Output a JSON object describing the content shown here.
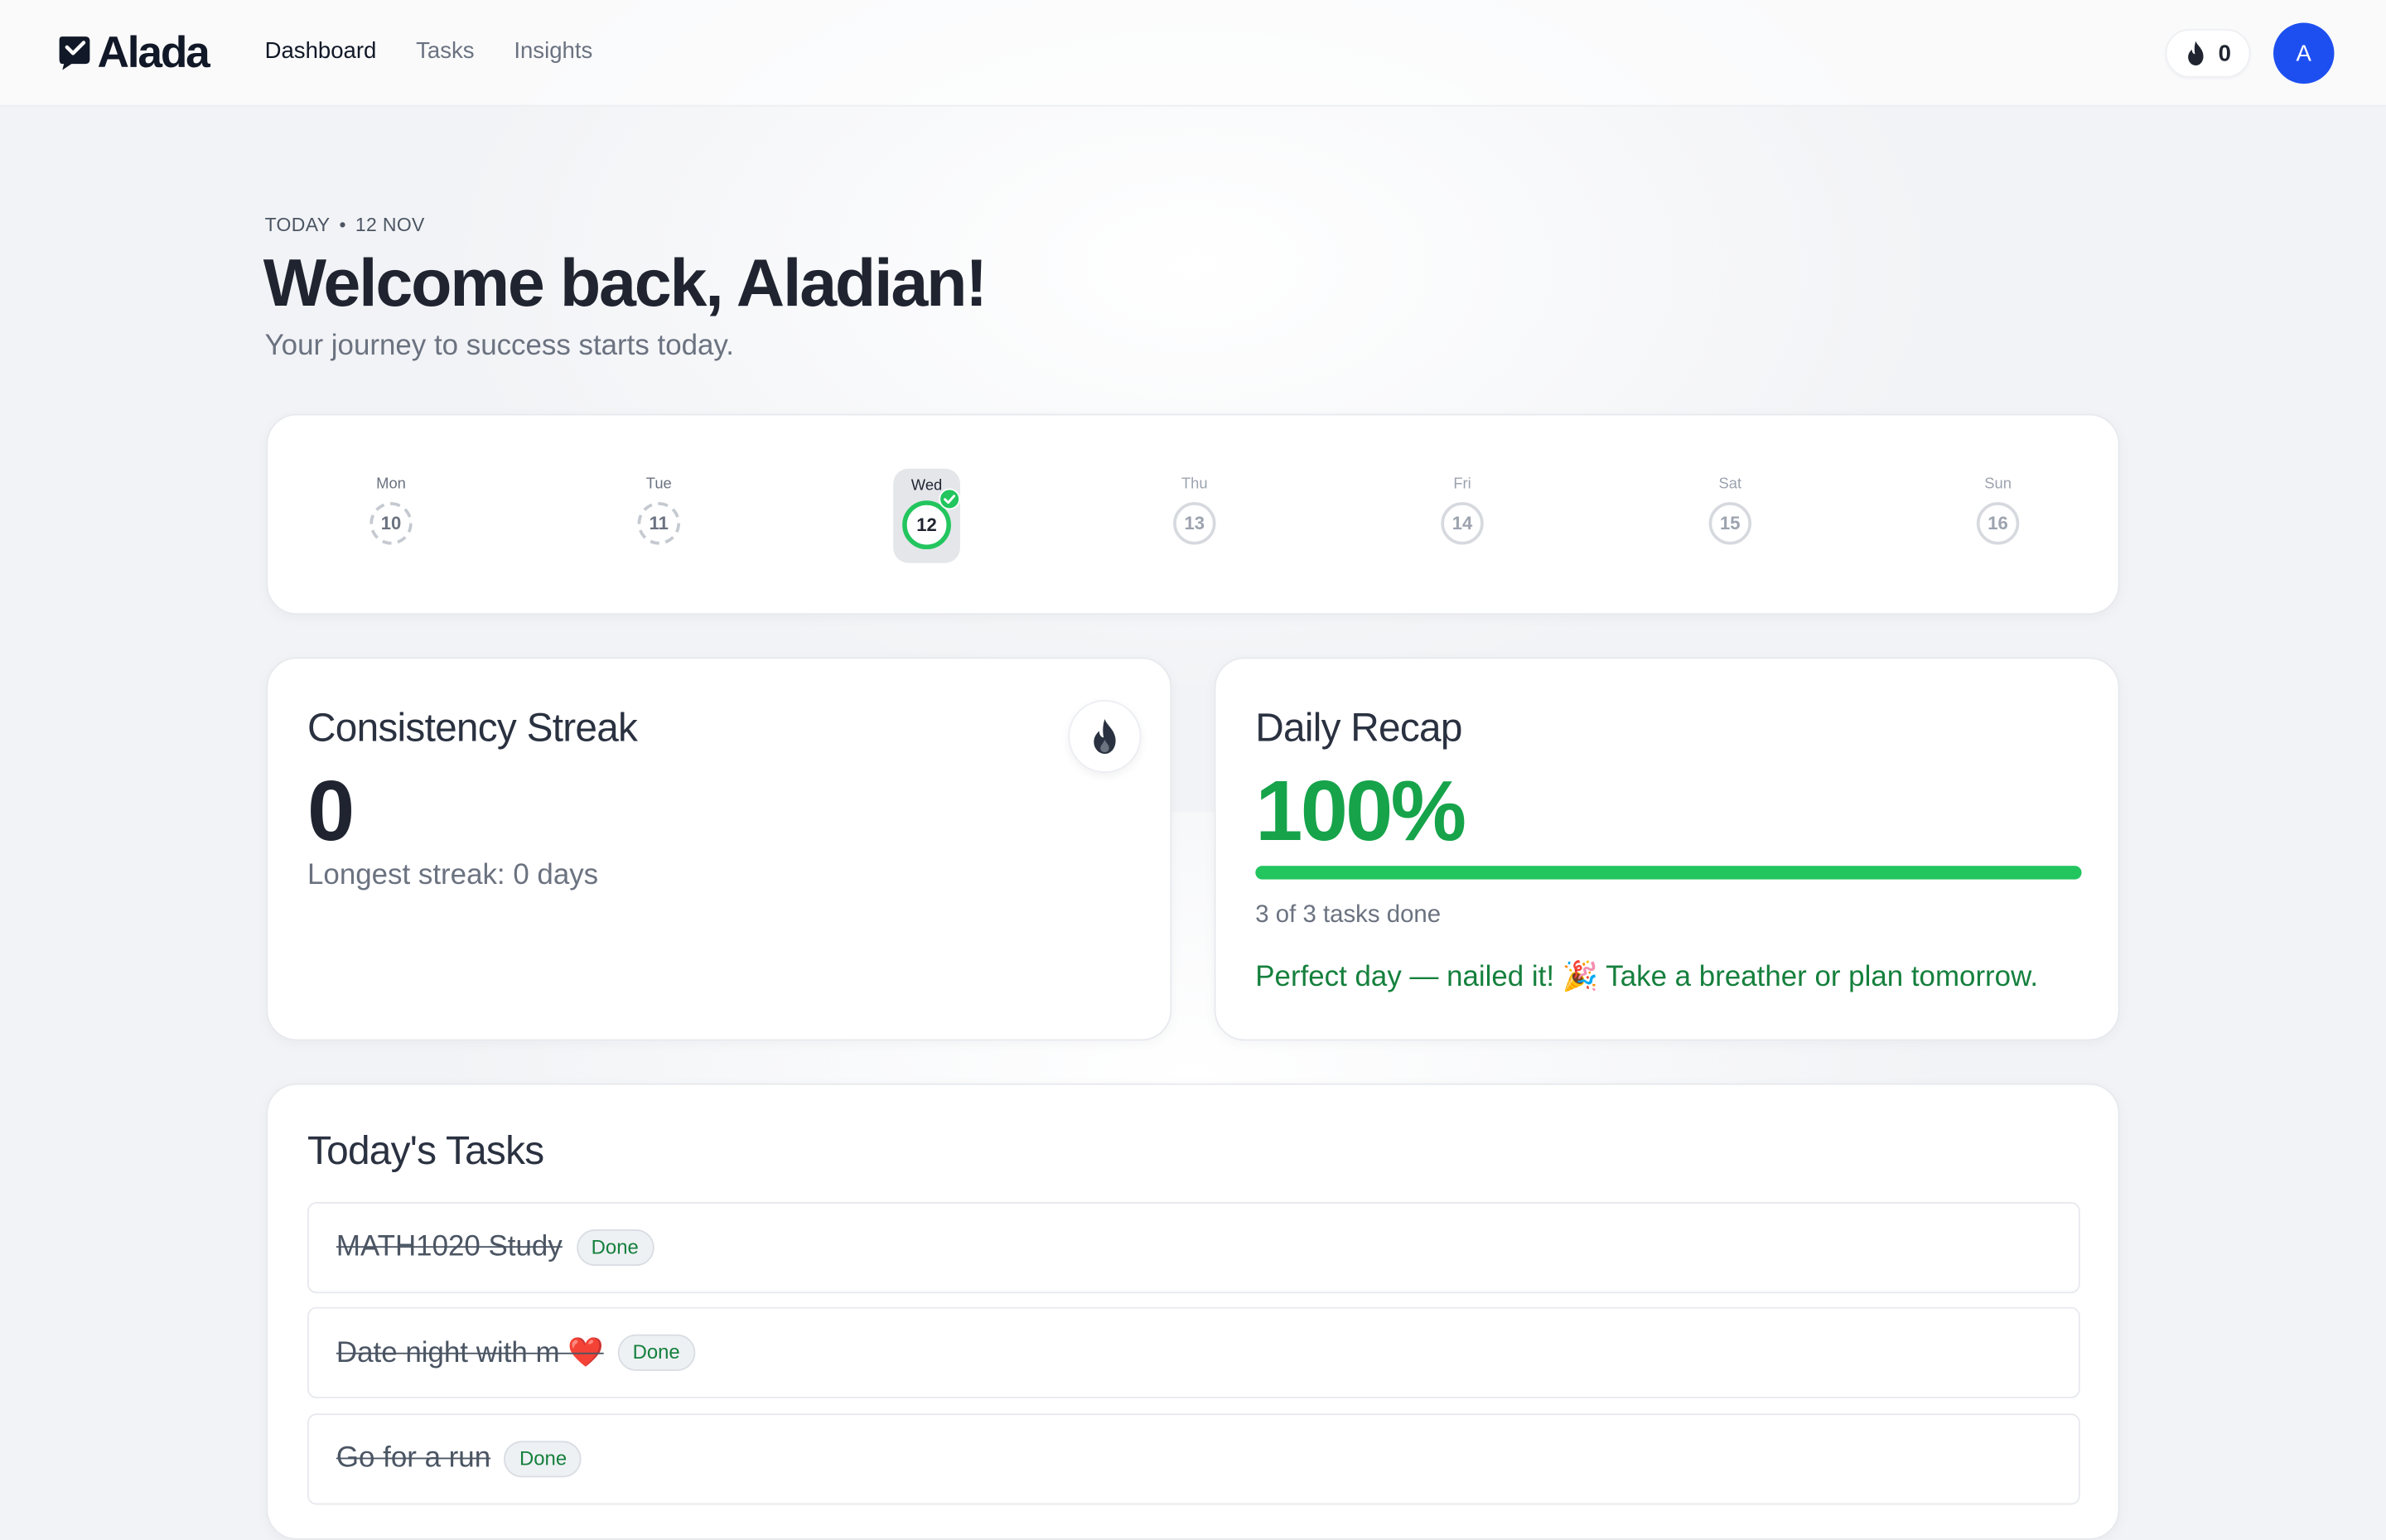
{
  "app": {
    "brand": "Alada",
    "nav": [
      {
        "label": "Dashboard",
        "active": true
      },
      {
        "label": "Tasks",
        "active": false
      },
      {
        "label": "Insights",
        "active": false
      }
    ],
    "streak_count": "0",
    "avatar_initial": "A",
    "avatar_color": "#1d4ff0"
  },
  "hero": {
    "eyebrow_day": "TODAY",
    "eyebrow_sep": "•",
    "eyebrow_date": "12 NOV",
    "title": "Welcome back, Aladian!",
    "subtitle": "Your journey to success starts today."
  },
  "week": {
    "days": [
      {
        "label": "Mon",
        "date": "10",
        "state": "past"
      },
      {
        "label": "Tue",
        "date": "11",
        "state": "past"
      },
      {
        "label": "Wed",
        "date": "12",
        "state": "today-complete"
      },
      {
        "label": "Thu",
        "date": "13",
        "state": "future"
      },
      {
        "label": "Fri",
        "date": "14",
        "state": "future"
      },
      {
        "label": "Sat",
        "date": "15",
        "state": "future"
      },
      {
        "label": "Sun",
        "date": "16",
        "state": "future"
      }
    ]
  },
  "streak": {
    "title": "Consistency Streak",
    "value": "0",
    "longest": "Longest streak: 0 days",
    "icon": "flame-icon"
  },
  "recap": {
    "title": "Daily Recap",
    "percent_label": "100%",
    "progress_fraction": 1.0,
    "count": "3 of 3 tasks done",
    "message": "Perfect day — nailed it! 🎉 Take a breather or plan tomorrow.",
    "accent": "#16a34a"
  },
  "tasks": {
    "title": "Today's Tasks",
    "items": [
      {
        "name": "MATH1020 Study",
        "status": "Done"
      },
      {
        "name": "Date night with m ❤️",
        "status": "Done"
      },
      {
        "name": "Go for a run",
        "status": "Done"
      }
    ]
  }
}
